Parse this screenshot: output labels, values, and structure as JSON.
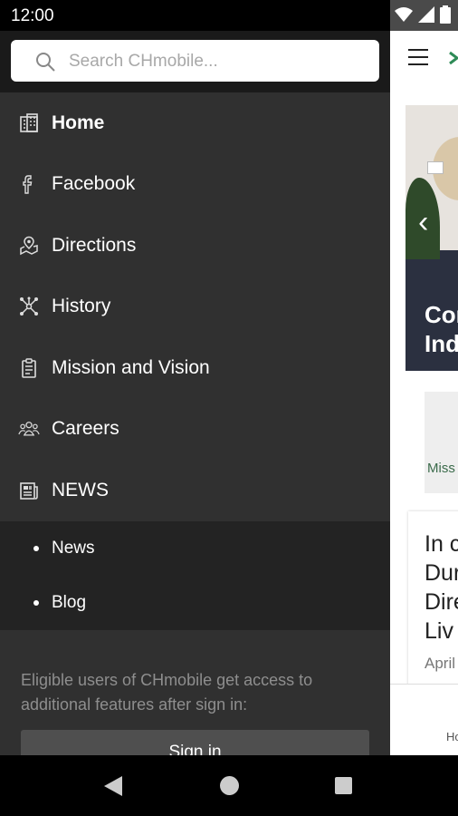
{
  "status_bar": {
    "time": "12:00"
  },
  "drawer": {
    "search": {
      "placeholder": "Search CHmobile..."
    },
    "menu": [
      {
        "label": "Home",
        "icon": "building-icon",
        "active": true
      },
      {
        "label": "Facebook",
        "icon": "facebook-icon"
      },
      {
        "label": "Directions",
        "icon": "map-pin-icon"
      },
      {
        "label": "History",
        "icon": "network-icon"
      },
      {
        "label": "Mission and Vision",
        "icon": "clipboard-icon"
      },
      {
        "label": "Careers",
        "icon": "people-group-icon"
      },
      {
        "label": "NEWS",
        "icon": "newspaper-icon"
      }
    ],
    "submenu": [
      {
        "label": "News"
      },
      {
        "label": "Blog"
      }
    ],
    "info_text": "Eligible users of CHmobile get access to additional features after sign in:",
    "sign_in_label": "Sign in"
  },
  "background_app": {
    "hero_title_lines": [
      "Cor",
      "Ind"
    ],
    "card1_text": "Miss",
    "card2_title_lines": [
      "In c",
      "Dur",
      "Dire",
      "Liv"
    ],
    "card2_date": "April",
    "bottom_nav_label": "Ho"
  },
  "colors": {
    "drawer_bg": "#303030",
    "submenu_bg": "#232323",
    "accent_green": "#3b6b4b"
  }
}
